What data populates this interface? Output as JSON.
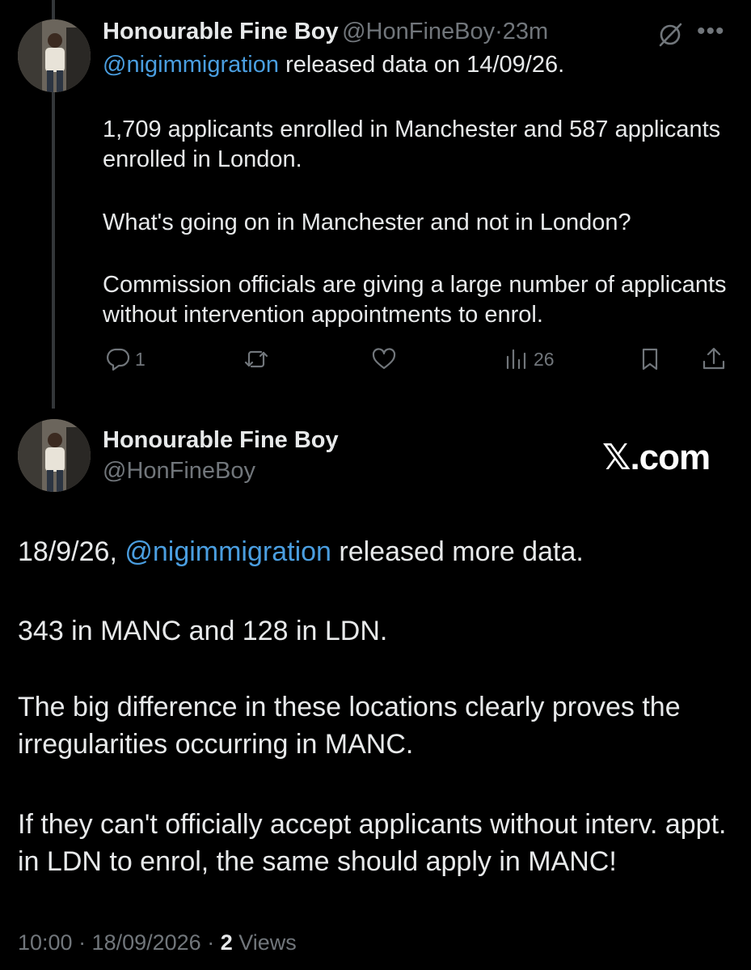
{
  "reply_tweet": {
    "author_name": "Honourable Fine Boy",
    "author_handle": "@HonFineBoy",
    "separator": "·",
    "time": "23m",
    "mention": "@nigimmigration",
    "line1_rest": " released data on 14/09/26.",
    "para2": "1,709 applicants enrolled in Manchester and 587 applicants enrolled in London.",
    "para3": "What's going on in Manchester and not in London?",
    "para4": "Commission officials are giving a large number of applicants without intervention appointments to enrol.",
    "actions": {
      "reply_count": "1",
      "retweet_count": "",
      "like_count": "",
      "views_count": "26"
    },
    "icons": [
      "grok-icon",
      "more-icon",
      "reply-icon",
      "retweet-icon",
      "like-icon",
      "views-icon",
      "bookmark-icon",
      "share-icon"
    ]
  },
  "main_tweet": {
    "author_name": "Honourable Fine Boy",
    "author_handle": "@HonFineBoy",
    "watermark": "𝕏.com",
    "line1_pre": "18/9/26, ",
    "mention": "@nigimmigration",
    "line1_rest": " released more data.",
    "para2": "343 in MANC and 128 in LDN.",
    "para3": "The big difference in these locations clearly proves the irregularities occurring in MANC.",
    "para4": "If they can't officially accept applicants without interv. appt. in LDN to enrol, the same should apply in MANC!",
    "timestamp": "10:00 · 18/09/2026 · ",
    "views_number": "2",
    "views_label": " Views"
  },
  "colors": {
    "background": "#000000",
    "text": "#e7e9ea",
    "muted": "#71767b",
    "link": "#4a9ee0"
  }
}
